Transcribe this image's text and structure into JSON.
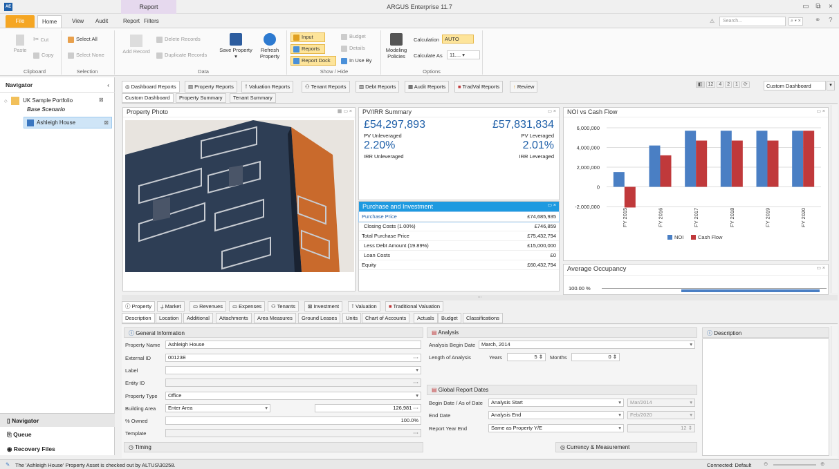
{
  "titlebar": {
    "app_icon": "AE",
    "context_tab": "Report",
    "title": "ARGUS Enterprise 11.7"
  },
  "tabs": [
    "File",
    "Home",
    "View",
    "Audit",
    "Report",
    "Filters"
  ],
  "search": {
    "placeholder": "Search..."
  },
  "ribbon": {
    "clipboard": {
      "paste": "Paste",
      "cut": "Cut",
      "copy": "Copy",
      "label": "Clipboard"
    },
    "selection": {
      "select_all": "Select All",
      "select_none": "Select None",
      "label": "Selection"
    },
    "data": {
      "add_record": "Add Record",
      "delete_records": "Delete Records",
      "duplicate_records": "Duplicate Records",
      "save_property": "Save Property",
      "refresh_property": "Refresh Property",
      "label": "Data"
    },
    "show_hide": {
      "input": "Input",
      "reports": "Reports",
      "report_dock": "Report Dock",
      "budget": "Budget",
      "details": "Details",
      "in_use_by": "In Use By",
      "label": "Show / Hide"
    },
    "options": {
      "modeling_policies": "Modeling Policies",
      "calculation_label": "Calculation",
      "calculation_value": "AUTO",
      "calculate_as_label": "Calculate As",
      "calculate_as_value": "11....",
      "label": "Options"
    }
  },
  "navigator": {
    "title": "Navigator",
    "portfolio": "UK Sample Portfolio",
    "scenario": "Base Scenario",
    "property": "Ashleigh House",
    "bottom_items": [
      "Navigator",
      "Queue",
      "Recovery Files"
    ]
  },
  "dash_tabs": [
    "Dashboard Reports",
    "Property Reports",
    "Valuation Reports",
    "Tenant Reports",
    "Debt Reports",
    "Audit Reports",
    "TradVal Reports",
    "Review"
  ],
  "dash_subtabs": [
    "Custom Dashboard",
    "Property Summary",
    "Tenant Summary"
  ],
  "dashboard_select": "Custom Dashboard",
  "page_nums": [
    "12",
    "4",
    "2",
    "1"
  ],
  "property_photo": {
    "title": "Property Photo"
  },
  "pv_irr": {
    "title": "PV/IRR Summary",
    "pv_unlev": "£54,297,893",
    "pv_unlev_label": "PV Unleveraged",
    "pv_lev": "£57,831,834",
    "pv_lev_label": "PV Leveraged",
    "irr_unlev": "2.20%",
    "irr_unlev_label": "IRR Unleveraged",
    "irr_lev": "2.01%",
    "irr_lev_label": "IRR Leveraged"
  },
  "purchase": {
    "title": "Purchase and Investment",
    "rows": [
      {
        "label": "Purchase Price",
        "value": "£74,685,935"
      },
      {
        "label": "Closing Costs (1.00%)",
        "value": "£746,859"
      },
      {
        "label": "Total Purchase Price",
        "value": "£75,432,794"
      },
      {
        "label": "Less Debt Amount (19.89%)",
        "value": "£15,000,000"
      },
      {
        "label": "Loan Costs",
        "value": "£0"
      },
      {
        "label": "Equity",
        "value": "£60,432,794"
      }
    ]
  },
  "chart_data": {
    "type": "bar",
    "title": "NOI vs Cash Flow",
    "categories": [
      "FY 2015",
      "FY 2016",
      "FY 2017",
      "FY 2018",
      "FY 2019",
      "FY 2020"
    ],
    "series": [
      {
        "name": "NOI",
        "color": "#4a7fc4",
        "values": [
          1500000,
          4200000,
          5700000,
          5700000,
          5700000,
          5700000
        ]
      },
      {
        "name": "Cash Flow",
        "color": "#c0393b",
        "values": [
          -2100000,
          3200000,
          4700000,
          4700000,
          4700000,
          5700000
        ]
      }
    ],
    "yticks": [
      "6,000,000",
      "4,000,000",
      "2,000,000",
      "0",
      "-2,000,000"
    ],
    "ylim": [
      -2000000,
      6000000
    ],
    "legend": "bottom"
  },
  "occupancy": {
    "title": "Average Occupancy",
    "tick": "100.00 %"
  },
  "bottom_tabs": [
    "Property",
    "Market",
    "Revenues",
    "Expenses",
    "Tenants",
    "Investment",
    "Valuation",
    "Traditional Valuation"
  ],
  "sub_tabs": [
    "Description",
    "Location",
    "Additional",
    "Attachments",
    "Area Measures",
    "Ground Leases",
    "Units",
    "Chart of Accounts",
    "Actuals",
    "Budget",
    "Classifications"
  ],
  "general": {
    "title": "General Information",
    "property_name_label": "Property Name",
    "property_name": "Ashleigh House",
    "external_id_label": "External ID",
    "external_id": "00123E",
    "label_label": "Label",
    "entity_id_label": "Entity ID",
    "property_type_label": "Property Type",
    "property_type": "Office",
    "building_area_label": "Building Area",
    "building_area_mode": "Enter Area",
    "building_area": "126,981",
    "owned_label": "% Owned",
    "owned": "100.0%",
    "template_label": "Template",
    "timing": "Timing"
  },
  "analysis": {
    "title": "Analysis",
    "begin_label": "Analysis Begin Date",
    "begin": "March, 2014",
    "length_label": "Length of Analysis",
    "years_label": "Years",
    "years": "5",
    "months_label": "Months",
    "months": "0"
  },
  "report_dates": {
    "title": "Global Report Dates",
    "begin_label": "Begin Date / As of Date",
    "begin": "Analysis Start",
    "begin_date": "Mar/2014",
    "end_label": "End Date",
    "end": "Analysis End",
    "end_date": "Feb/2020",
    "year_end_label": "Report Year End",
    "year_end": "Same as Property Y/E",
    "year_end_num": "12"
  },
  "currency": {
    "title": "Currency & Measurement"
  },
  "description": {
    "title": "Description"
  },
  "status": {
    "message": "The 'Ashleigh House' Property Asset is checked out by ALTUS\\30258.",
    "connection": "Connected: Default"
  },
  "colors": {
    "accent": "#1e9ae0",
    "noi": "#4a7fc4",
    "cash_flow": "#c0393b",
    "file_tab": "#f5a623"
  }
}
